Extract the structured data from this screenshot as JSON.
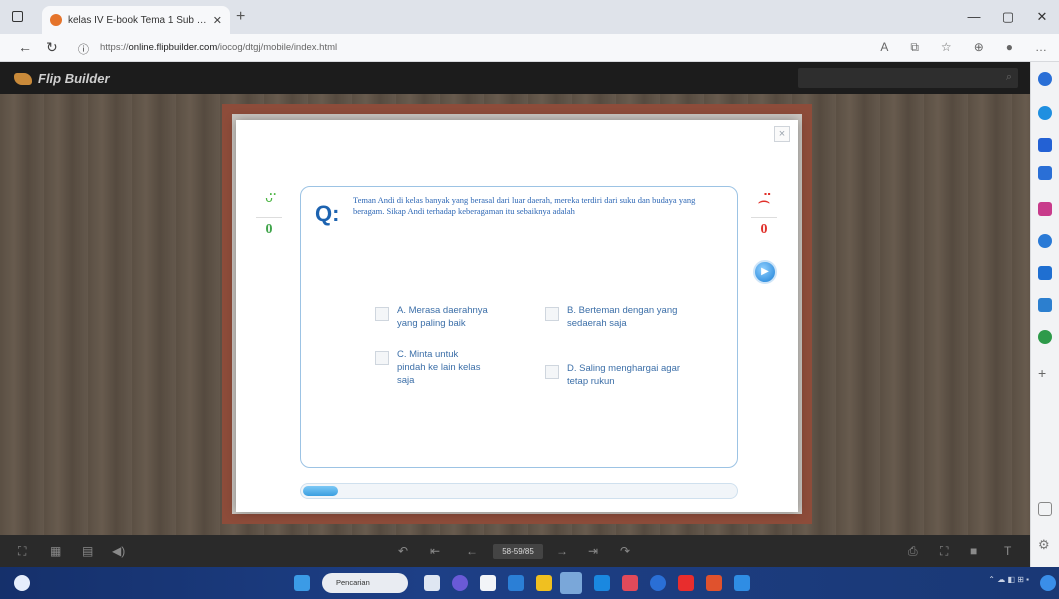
{
  "browser": {
    "tab_title": "kelas IV E-book Tema 1 Sub Ten",
    "tab_close": "✕",
    "new_tab": "+",
    "url_prefix": "https://",
    "url_host": "online.flipbuilder.com",
    "url_path": "/iocog/dtgj/mobile/index.html",
    "window_controls": [
      "—",
      "▢",
      "✕"
    ]
  },
  "app": {
    "brand": "Flip Builder"
  },
  "quiz": {
    "close": "×",
    "q_mark": "Q:",
    "question": "Teman Andi di kelas banyak yang berasal dari luar daerah, mereka terdiri dari suku dan budaya yang beragam. Sikap Andi terhadap keberagaman itu sebaiknya adalah",
    "options": [
      {
        "label": "A. Merasa daerahnya yang paling baik"
      },
      {
        "label": "B. Berteman dengan yang sedaerah saja"
      },
      {
        "label": "C. Minta untuk pindah ke lain kelas saja"
      },
      {
        "label": "D. Saling menghargai agar tetap rukun"
      }
    ],
    "correct_count": "0",
    "wrong_count": "0",
    "progress_fraction": 0.08
  },
  "controls": {
    "page_indicator": "58-59/85"
  },
  "taskbar": {
    "search_label": "Pencarian"
  },
  "icons": {
    "smile": "smile-icon",
    "sad": "sad-icon",
    "next": "play-icon",
    "search": "search-icon"
  },
  "colors": {
    "accent": "#1d63b0",
    "correct": "#4bb543",
    "wrong": "#e0302a",
    "book_border": "#a65a45"
  }
}
